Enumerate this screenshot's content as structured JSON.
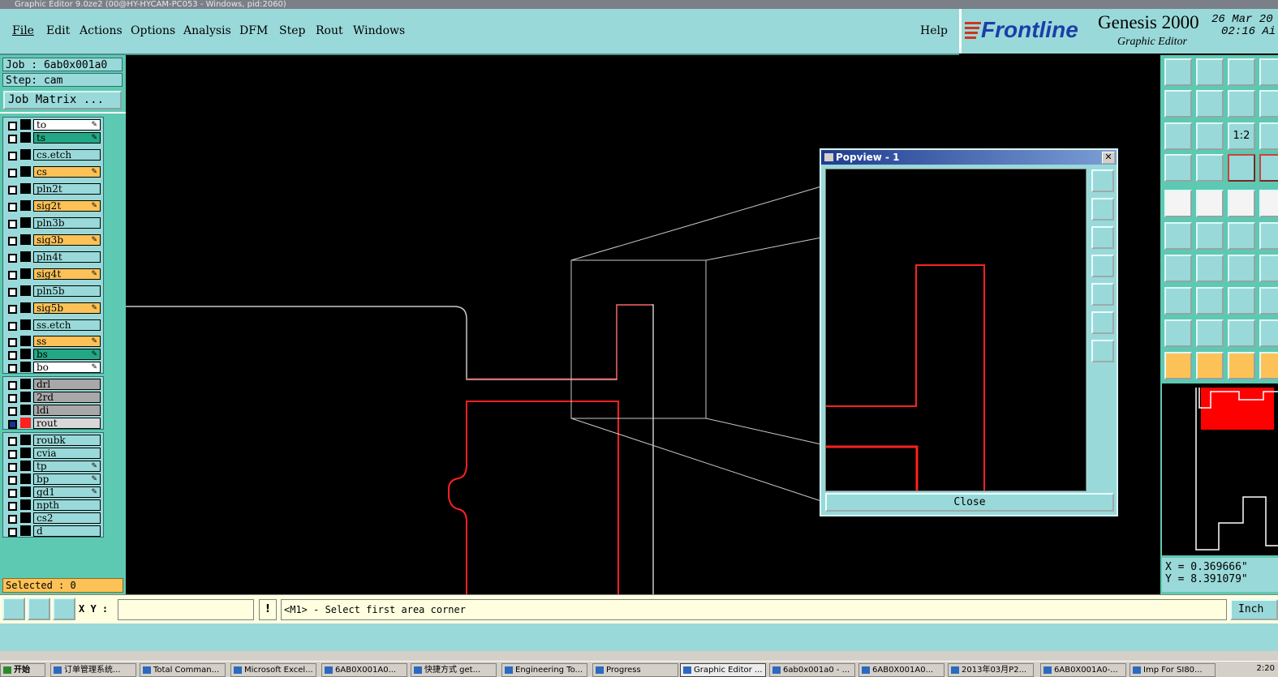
{
  "window": {
    "title": "Graphic Editor 9.0ze2 (00@HY-HYCAM-PC053 - Windows, pid:2060)"
  },
  "menu": [
    "File",
    "Edit",
    "Actions",
    "Options",
    "Analysis",
    "DFM",
    "Step",
    "Rout",
    "Windows"
  ],
  "help_label": "Help",
  "brand": {
    "logo": "Frontline",
    "product": "Genesis 2000",
    "subtitle": "Graphic Editor",
    "date": "26 Mar 20",
    "time": "02:16 Ai"
  },
  "job": {
    "job_label": "Job : 6ab0x001a0",
    "step_label": "Step: cam",
    "job_matrix_label": "Job Matrix ..."
  },
  "layer_groups": [
    {
      "layers": [
        {
          "name": "to",
          "color": "#ffffff",
          "editable": true
        },
        {
          "name": "ts",
          "color": "#22a884",
          "editable": true
        },
        {
          "name": "cs.etch",
          "color": "#9ad9d9",
          "editable": false
        },
        {
          "name": "cs",
          "color": "#fdc257",
          "editable": true
        },
        {
          "name": "pln2t",
          "color": "#9ad9d9",
          "editable": false
        },
        {
          "name": "sig2t",
          "color": "#fdc257",
          "editable": true
        },
        {
          "name": "pln3b",
          "color": "#9ad9d9",
          "editable": false
        },
        {
          "name": "sig3b",
          "color": "#fdc257",
          "editable": true
        },
        {
          "name": "pln4t",
          "color": "#9ad9d9",
          "editable": false
        },
        {
          "name": "sig4t",
          "color": "#fdc257",
          "editable": true
        },
        {
          "name": "pln5b",
          "color": "#9ad9d9",
          "editable": false
        },
        {
          "name": "sig5b",
          "color": "#fdc257",
          "editable": true
        },
        {
          "name": "ss.etch",
          "color": "#9ad9d9",
          "editable": false
        },
        {
          "name": "ss",
          "color": "#fdc257",
          "editable": true
        },
        {
          "name": "bs",
          "color": "#22a884",
          "editable": true
        },
        {
          "name": "bo",
          "color": "#ffffff",
          "editable": true
        }
      ]
    },
    {
      "layers": [
        {
          "name": "drl",
          "color": "#a8a8a8",
          "editable": false
        },
        {
          "name": "2rd",
          "color": "#a8a8a8",
          "editable": false
        },
        {
          "name": "ldi",
          "color": "#a8a8a8",
          "editable": false
        },
        {
          "name": "rout",
          "color": "#d8d8d8",
          "editable": false,
          "active": true
        }
      ]
    },
    {
      "layers": [
        {
          "name": "roubk",
          "color": "#9ad9d9",
          "editable": false
        },
        {
          "name": "cvia",
          "color": "#9ad9d9",
          "editable": false
        },
        {
          "name": "tp",
          "color": "#9ad9d9",
          "editable": true
        },
        {
          "name": "bp",
          "color": "#9ad9d9",
          "editable": true
        },
        {
          "name": "gd1",
          "color": "#9ad9d9",
          "editable": true
        },
        {
          "name": "npth",
          "color": "#9ad9d9",
          "editable": false
        },
        {
          "name": "cs2",
          "color": "#9ad9d9",
          "editable": false
        },
        {
          "name": "d",
          "color": "#9ad9d9",
          "editable": false
        }
      ]
    }
  ],
  "selected_label": "Selected : 0",
  "popview": {
    "title": "Popview - 1",
    "close_label": "Close"
  },
  "coords": {
    "x": "X = 0.369666\"",
    "y": "Y = 8.391079\""
  },
  "status": {
    "xy_label": "X Y :",
    "xy_value": "",
    "message": "<M1> - Select first area corner",
    "units": "Inch"
  },
  "taskbar": {
    "start": "开始",
    "clock": "2:20",
    "tasks": [
      "订单管理系统...",
      "Total Comman...",
      "Microsoft Excel...",
      "6AB0X001A0...",
      "快捷方式 get...",
      "Engineering To...",
      "Progress",
      "Graphic Editor ...",
      "6ab0x001a0 - ...",
      "6AB0X001A0...",
      "2013年03月P2...",
      "6AB0X001A0-...",
      "Imp For SI80..."
    ]
  },
  "colors": {
    "panel": "#9ad9d9",
    "panel_dark": "#5ec9b2",
    "rout_red": "#ff2020",
    "outline_white": "#c8c8c8"
  }
}
